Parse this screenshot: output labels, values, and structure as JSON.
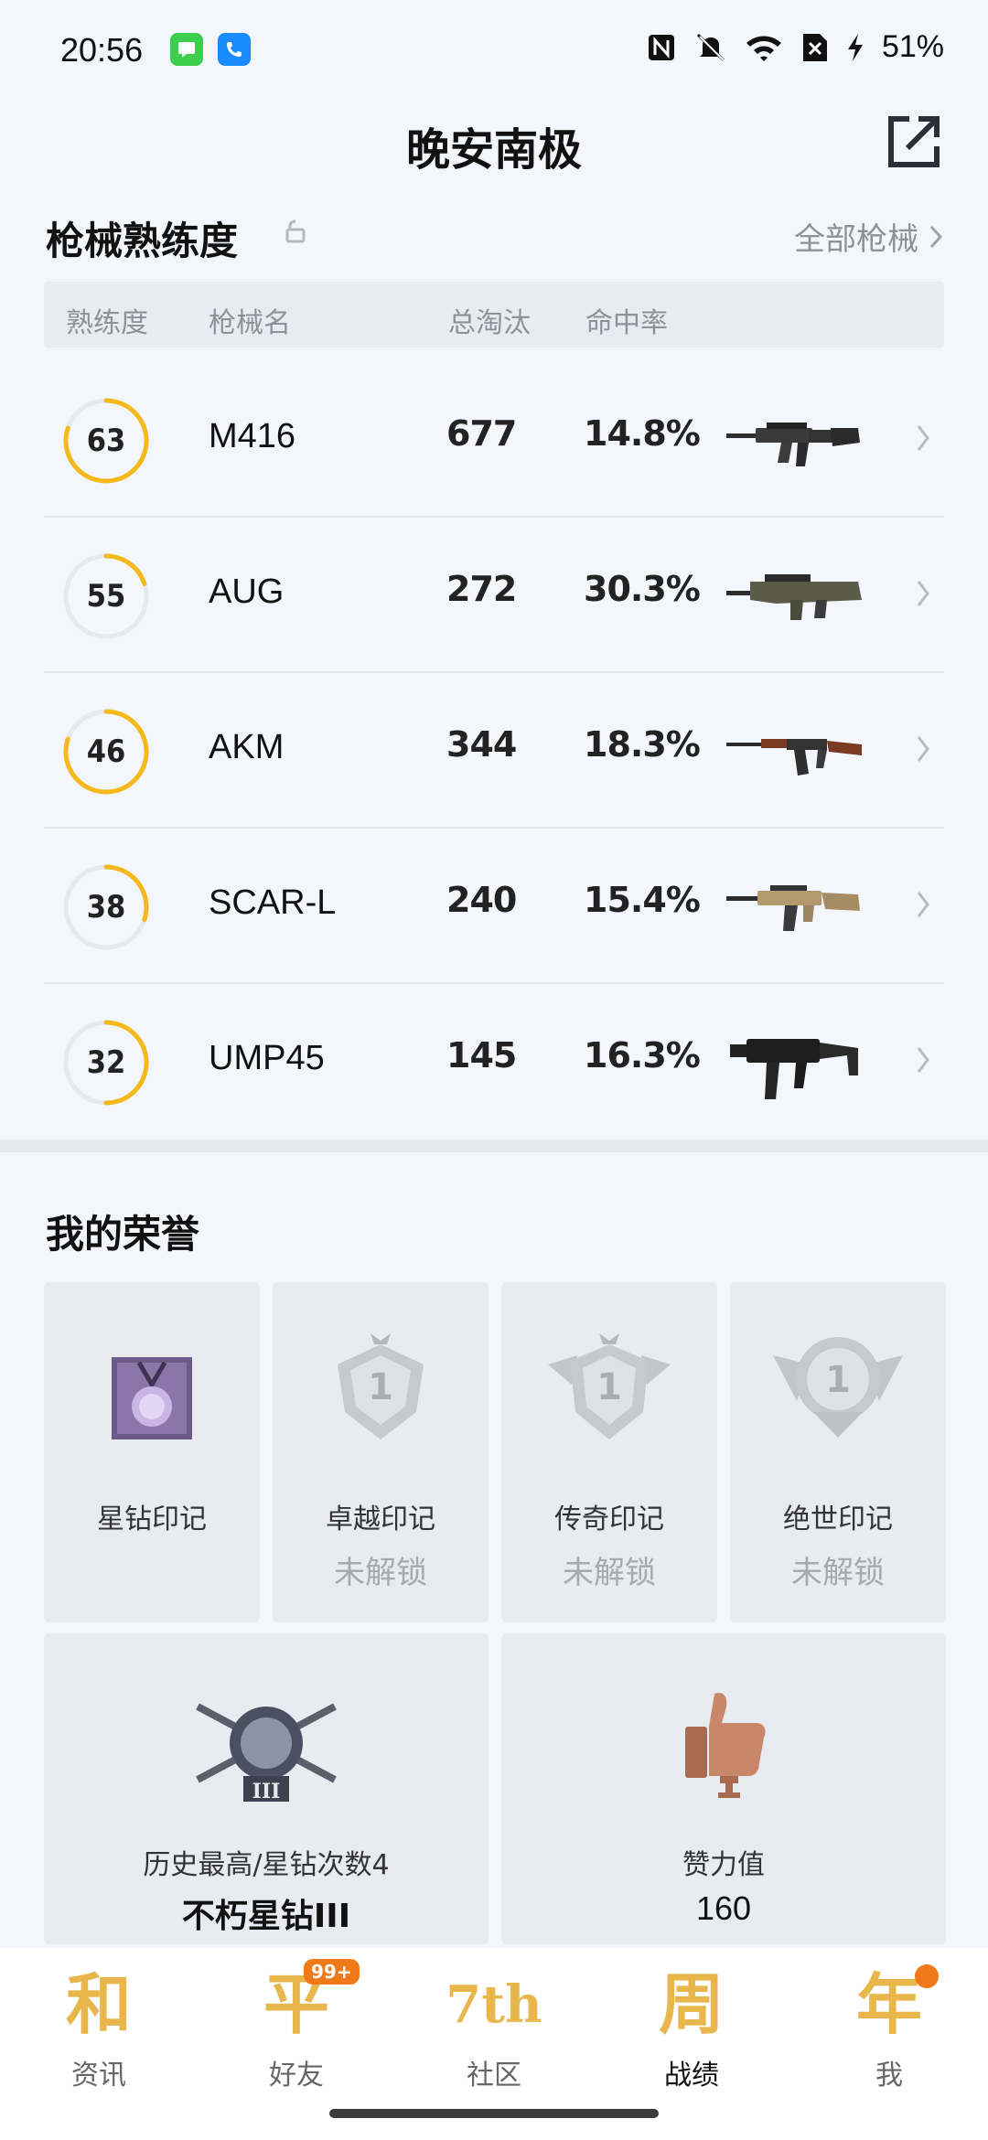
{
  "status_bar": {
    "time": "20:56",
    "battery": "51%"
  },
  "header": {
    "title": "晚安南极"
  },
  "weapons": {
    "title": "枪械熟练度",
    "all_link": "全部枪械",
    "columns": [
      "熟练度",
      "枪械名",
      "总淘汰",
      "命中率"
    ],
    "rows": [
      {
        "level": "63",
        "progress": 0.8,
        "name": "M416",
        "kills": "677",
        "rate": "14.8%",
        "image": "m416-rifle"
      },
      {
        "level": "55",
        "progress": 0.2,
        "name": "AUG",
        "kills": "272",
        "rate": "30.3%",
        "image": "aug-rifle"
      },
      {
        "level": "46",
        "progress": 0.8,
        "name": "AKM",
        "kills": "344",
        "rate": "18.3%",
        "image": "akm-rifle"
      },
      {
        "level": "38",
        "progress": 0.3,
        "name": "SCAR-L",
        "kills": "240",
        "rate": "15.4%",
        "image": "scar-l-rifle"
      },
      {
        "level": "32",
        "progress": 0.5,
        "name": "UMP45",
        "kills": "145",
        "rate": "16.3%",
        "image": "ump45-smg"
      }
    ]
  },
  "honor": {
    "title": "我的荣誉",
    "badges": [
      {
        "label": "星钻印记",
        "status": ""
      },
      {
        "label": "卓越印记",
        "status": "未解锁"
      },
      {
        "label": "传奇印记",
        "status": "未解锁"
      },
      {
        "label": "绝世印记",
        "status": "未解锁"
      }
    ],
    "highest": {
      "label": "历史最高/星钻次数4",
      "value": "不朽星钻III"
    },
    "likes": {
      "label": "赞力值",
      "value": "160"
    }
  },
  "nav": {
    "items": [
      {
        "label": "资讯",
        "glyph": "和"
      },
      {
        "label": "好友",
        "glyph": "平",
        "badge": "99+"
      },
      {
        "label": "社区",
        "glyph": "7th"
      },
      {
        "label": "战绩",
        "glyph": "周"
      },
      {
        "label": "我",
        "glyph": "年"
      }
    ],
    "active": "战绩"
  },
  "colors": {
    "accent": "#f5b91e",
    "ring_track": "#e6e9ee",
    "nav_gold": "#e8b64a",
    "badge": "#f07a1a"
  }
}
